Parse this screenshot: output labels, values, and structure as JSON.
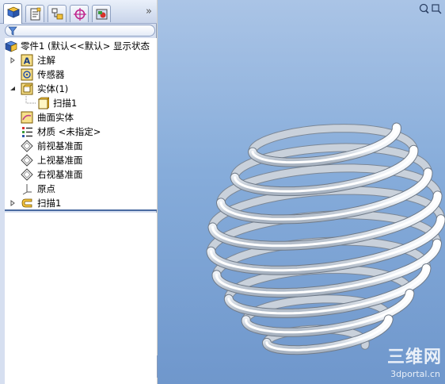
{
  "colors": {
    "viewport_bg": "#86acda",
    "spring": "#ffffff",
    "panel_bg": "#d6dff0",
    "tree_bg": "#ffffff"
  },
  "tabs": [
    {
      "icon": "feature-manager-icon",
      "active": true
    },
    {
      "icon": "property-manager-icon",
      "active": false
    },
    {
      "icon": "configuration-manager-icon",
      "active": false
    },
    {
      "icon": "dimxpert-icon",
      "active": false
    },
    {
      "icon": "display-manager-icon",
      "active": false
    }
  ],
  "tab_overflow": "»",
  "tree": {
    "root": "零件1 (默认<<默认> 显示状态",
    "items": [
      {
        "label": "注解",
        "icon": "annotation-icon",
        "expander": "collapsed"
      },
      {
        "label": "传感器",
        "icon": "sensor-icon",
        "expander": "none"
      },
      {
        "label": "实体(1)",
        "icon": "solid-bodies-icon",
        "expander": "expanded"
      },
      {
        "label": "扫描1",
        "icon": "solid-body-icon",
        "expander": "none",
        "child": true
      },
      {
        "label": "曲面实体",
        "icon": "surface-bodies-icon",
        "expander": "none"
      },
      {
        "label": "材质 <未指定>",
        "icon": "material-icon",
        "expander": "none"
      },
      {
        "label": "前视基准面",
        "icon": "plane-icon",
        "expander": "none"
      },
      {
        "label": "上视基准面",
        "icon": "plane-icon",
        "expander": "none"
      },
      {
        "label": "右视基准面",
        "icon": "plane-icon",
        "expander": "none"
      },
      {
        "label": "原点",
        "icon": "origin-icon",
        "expander": "none"
      },
      {
        "label": "扫描1",
        "icon": "sweep-feature-icon",
        "expander": "collapsed"
      }
    ]
  },
  "watermark": {
    "logo": "三维网",
    "url": "3dportal.cn"
  }
}
